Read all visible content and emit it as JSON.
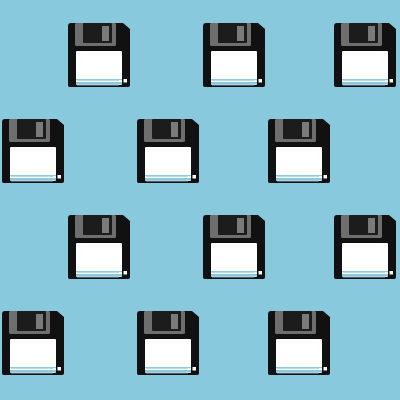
{
  "pattern": {
    "icon": "floppy-disk-icon",
    "colors": {
      "background": "#88C9DE",
      "body": "#111111",
      "shutter": "#1C1C1C",
      "shutter_frame": "#6E6E6E",
      "shutter_slot": "#7A7A7A",
      "label": "#FFFFFF",
      "label_lines": "#BFE0EC",
      "label_band": "#8CC9DD",
      "write_protect": "#FFFFFF"
    },
    "rows": 4,
    "columns_per_row": [
      3,
      3,
      3,
      3
    ]
  }
}
